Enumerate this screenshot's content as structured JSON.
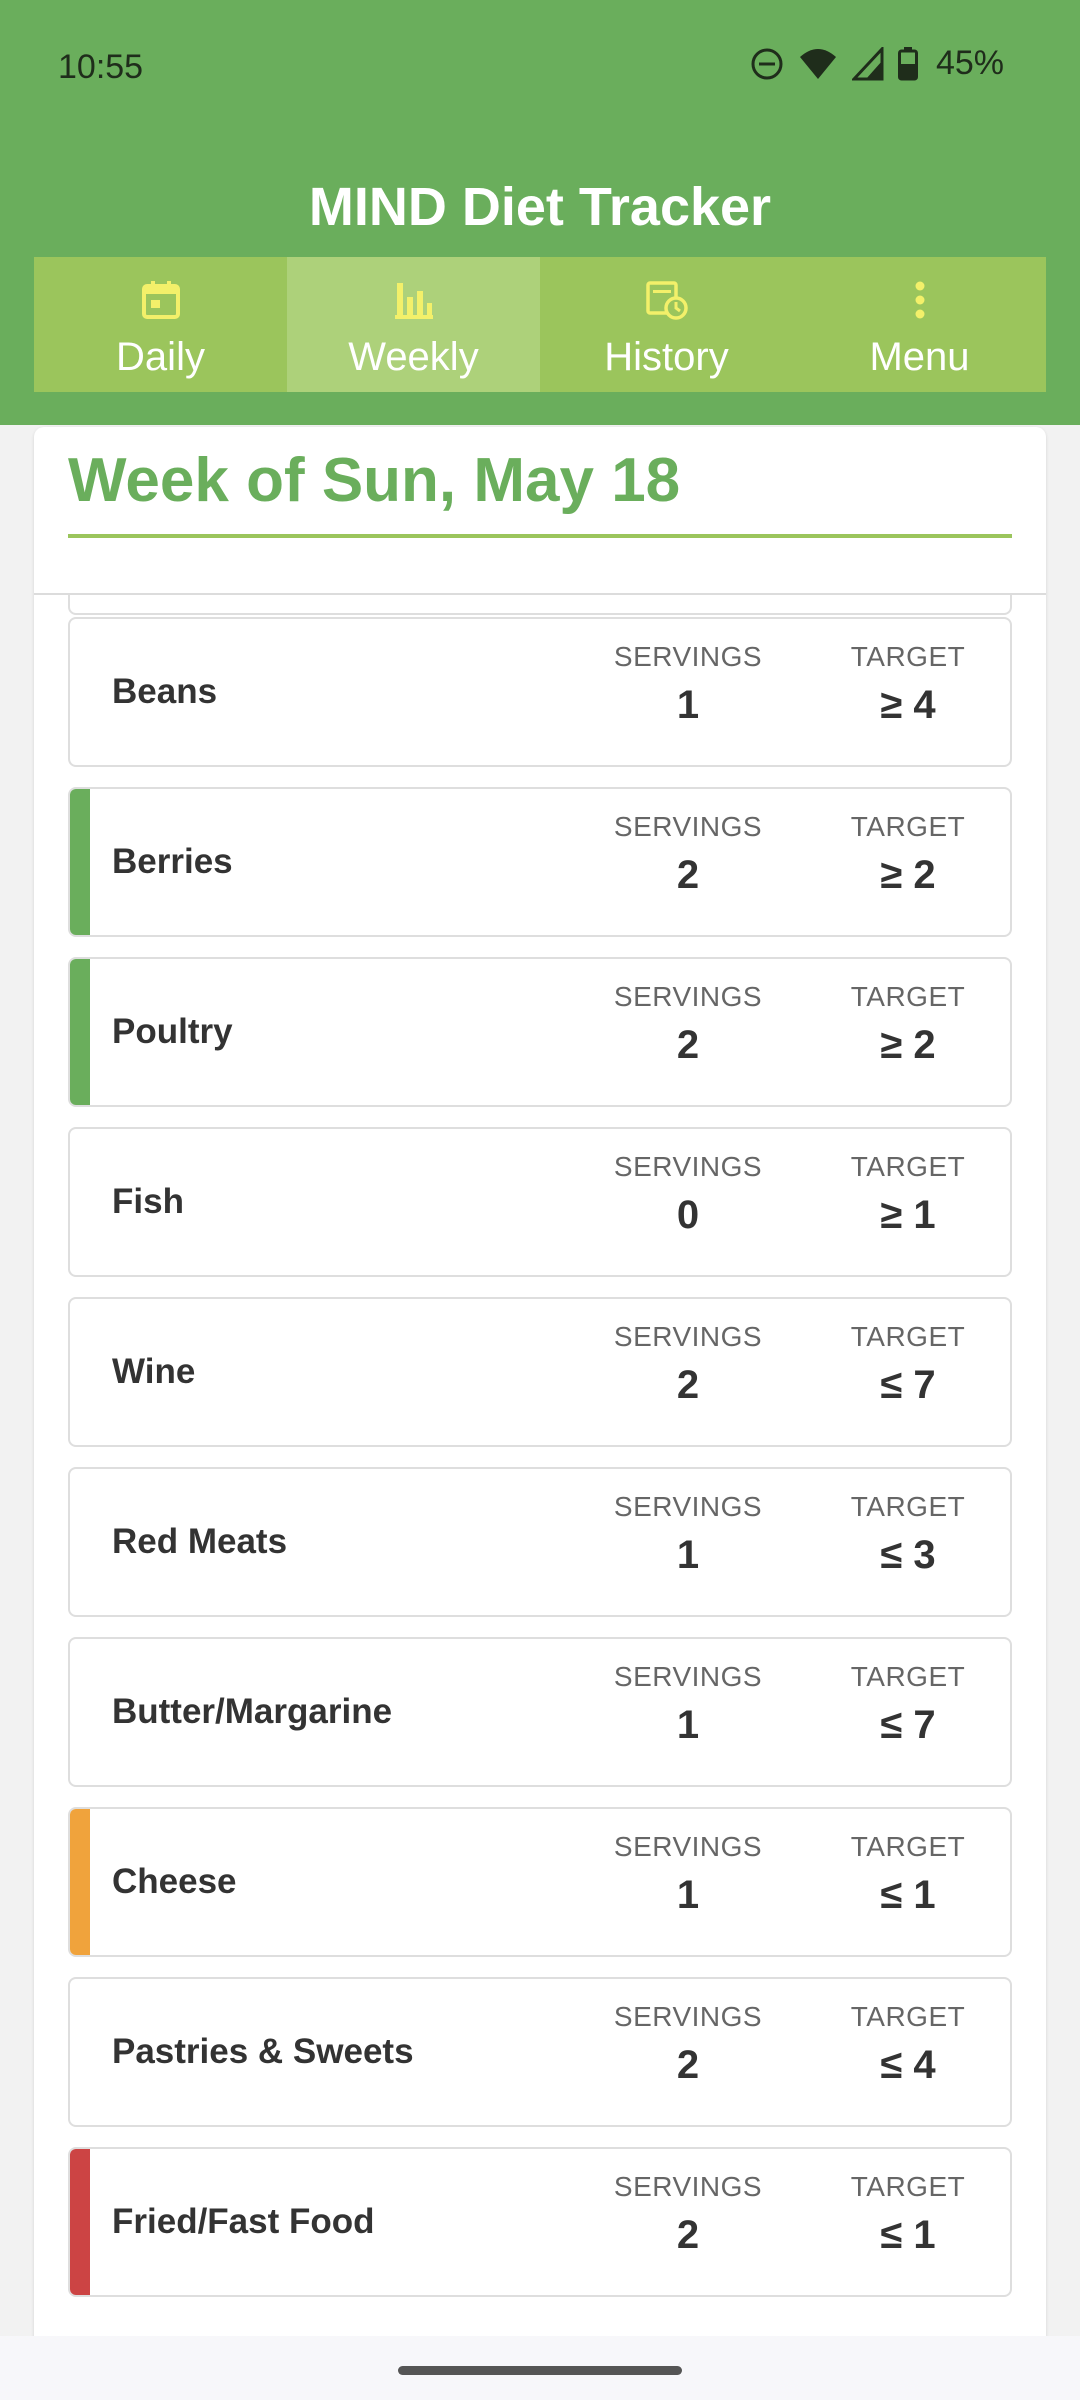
{
  "status_bar": {
    "time": "10:55",
    "battery": "45%",
    "icons": [
      "dnd-icon",
      "wifi-icon",
      "signal-icon",
      "battery-icon"
    ]
  },
  "header": {
    "title": "MIND Diet Tracker"
  },
  "tabs": [
    {
      "label": "Daily",
      "icon": "calendar-icon",
      "active": false
    },
    {
      "label": "Weekly",
      "icon": "bar-chart-icon",
      "active": true
    },
    {
      "label": "History",
      "icon": "history-icon",
      "active": false
    },
    {
      "label": "Menu",
      "icon": "more-vertical-icon",
      "active": false
    }
  ],
  "week": {
    "title": "Week of Sun, May 18"
  },
  "colors": {
    "brand": "#6aae5c",
    "tab_bar": "#9bc55c",
    "met": "#6aae5c",
    "warning": "#f0a33c",
    "over": "#cc4444"
  },
  "column_labels": {
    "servings": "SERVINGS",
    "target": "TARGET"
  },
  "items": [
    {
      "name": "Beans",
      "servings": "1",
      "target": "≥ 4",
      "status": "none"
    },
    {
      "name": "Berries",
      "servings": "2",
      "target": "≥ 2",
      "status": "met"
    },
    {
      "name": "Poultry",
      "servings": "2",
      "target": "≥ 2",
      "status": "met"
    },
    {
      "name": "Fish",
      "servings": "0",
      "target": "≥ 1",
      "status": "none"
    },
    {
      "name": "Wine",
      "servings": "2",
      "target": "≤ 7",
      "status": "none"
    },
    {
      "name": "Red Meats",
      "servings": "1",
      "target": "≤ 3",
      "status": "none"
    },
    {
      "name": "Butter/Margarine",
      "servings": "1",
      "target": "≤ 7",
      "status": "none"
    },
    {
      "name": "Cheese",
      "servings": "1",
      "target": "≤ 1",
      "status": "warning"
    },
    {
      "name": "Pastries & Sweets",
      "servings": "2",
      "target": "≤ 4",
      "status": "none"
    },
    {
      "name": "Fried/Fast Food",
      "servings": "2",
      "target": "≤ 1",
      "status": "over"
    }
  ]
}
